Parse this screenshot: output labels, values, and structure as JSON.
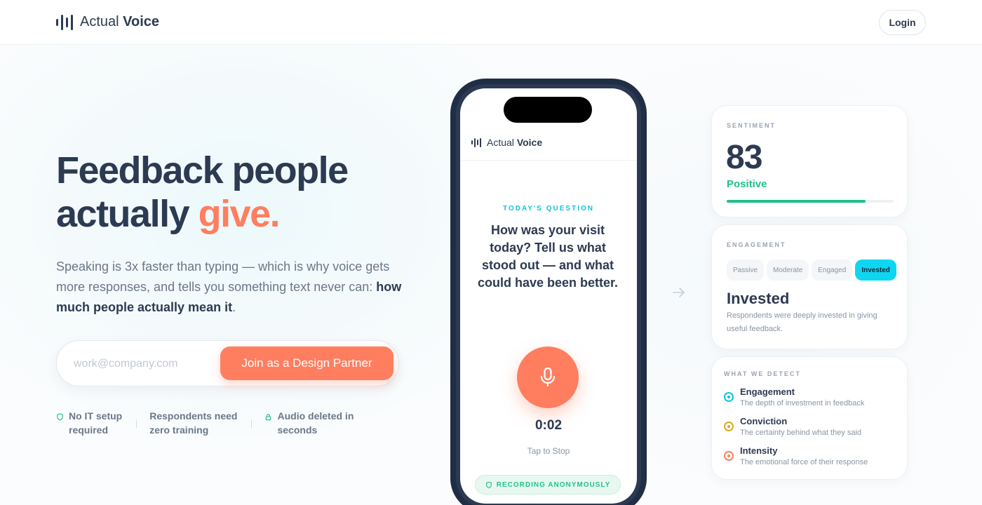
{
  "header": {
    "brand_light": "Actual",
    "brand_bold": "Voice",
    "login_label": "Login"
  },
  "hero": {
    "title_line1": "Feedback people",
    "title_line2_plain": "actually ",
    "title_line2_accent": "give.",
    "subtitle_plain": "Speaking is 3x faster than typing — which is why voice gets more responses, and tells you something text never can: ",
    "subtitle_bold": "how much people actually mean it",
    "subtitle_end": ".",
    "email_placeholder": "work@company.com",
    "cta_label": "Join as a Design Partner",
    "features": [
      {
        "icon": "shield-icon",
        "line1": "No IT setup",
        "line2": "required"
      },
      {
        "icon": "users-icon",
        "line1": "Respondents need",
        "line2": "zero training"
      },
      {
        "icon": "lock-icon",
        "line1": "Audio deleted in",
        "line2": "seconds"
      }
    ]
  },
  "phone": {
    "brand_light": "Actual",
    "brand_bold": "Voice",
    "question_label": "TODAY'S QUESTION",
    "question_text": "How was your visit today? Tell us what stood out — and what could have been better.",
    "timer": "0:02",
    "tap_label": "Tap to Stop",
    "badge_label": "RECORDING ANONYMOUSLY"
  },
  "sentiment": {
    "label": "SENTIMENT",
    "score": "83",
    "status": "Positive",
    "fill_fraction": 0.83
  },
  "engagement": {
    "label": "ENGAGEMENT",
    "levels": [
      "Passive",
      "Moderate",
      "Engaged",
      "Invested"
    ],
    "selected": "Invested",
    "title": "Invested",
    "description": "Respondents were deeply invested in giving useful feedback."
  },
  "detect": {
    "label": "WHAT WE DETECT",
    "items": [
      {
        "title": "Engagement",
        "description": "The depth of investment in feedback",
        "color": "#0fc4de"
      },
      {
        "title": "Conviction",
        "description": "The certainty behind what they said",
        "color": "#e0a91c"
      },
      {
        "title": "Intensity",
        "description": "The emotional force of their response",
        "color": "#ff7e5f"
      }
    ]
  },
  "colors": {
    "accent": "#ff7e5f",
    "navy": "#2c3a52",
    "cyan": "#0fd6f0",
    "green": "#1fc08a"
  }
}
